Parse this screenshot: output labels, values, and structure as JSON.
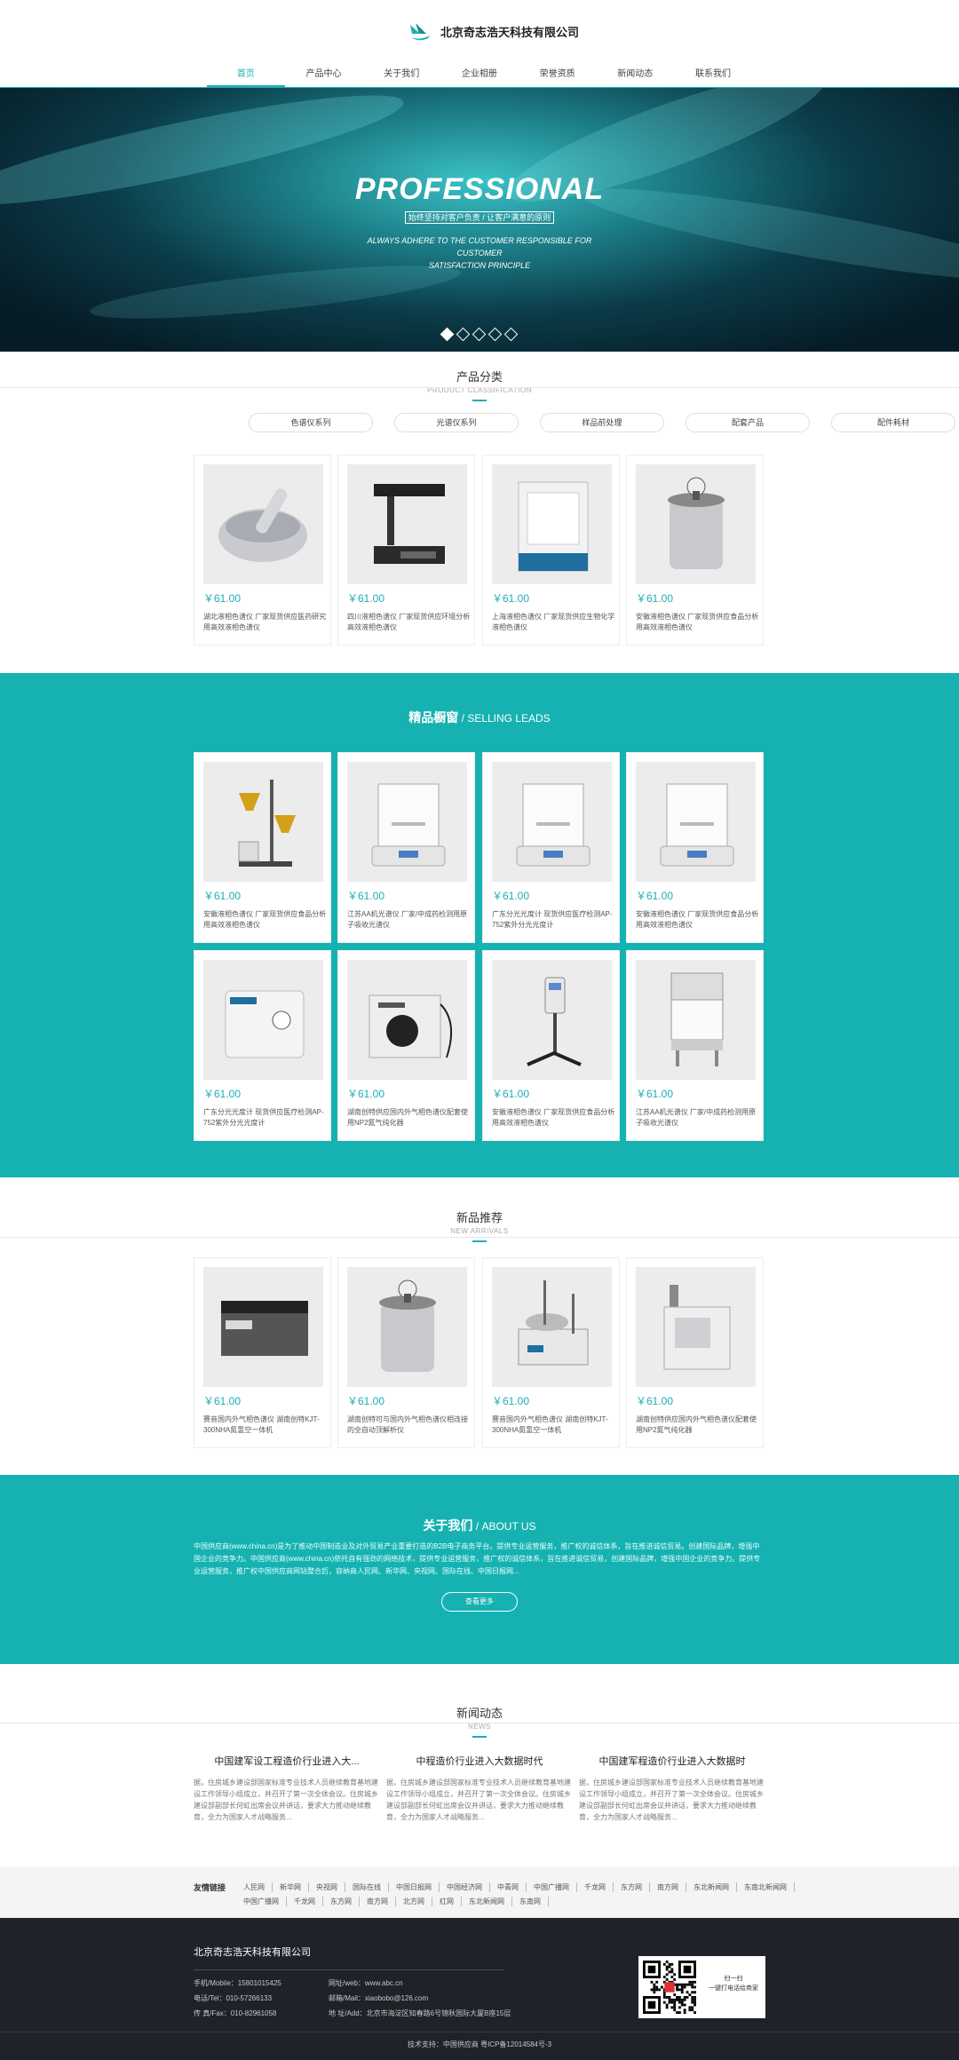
{
  "header": {
    "company": "北京奇志浩天科技有限公司",
    "nav": [
      "首页",
      "产品中心",
      "关于我们",
      "企业相册",
      "荣誉资质",
      "新闻动态",
      "联系我们"
    ],
    "active_index": 0
  },
  "banner": {
    "title": "PROFESSIONAL",
    "subtitle": "始终坚持对客户负责 / 让客户满意的原则",
    "en_line1": "ALWAYS ADHERE TO THE CUSTOMER RESPONSIBLE FOR CUSTOMER",
    "en_line2": "SATISFACTION PRINCIPLE",
    "dots": 5,
    "active_dot": 0
  },
  "classification": {
    "title": "产品分类",
    "subtitle": "PRODUCT CLASSIFICATION",
    "tabs": [
      "色谱仪系列",
      "光谱仪系列",
      "样品前处理",
      "配套产品",
      "配件耗材"
    ],
    "products": [
      {
        "price": "￥61.00",
        "desc": "湖北液相色谱仪 厂家现货供应医药研究用高效液相色谱仪",
        "icon": "mortar-icon"
      },
      {
        "price": "￥61.00",
        "desc": "四川液相色谱仪 厂家现货供应环境分析高效液相色谱仪",
        "icon": "uv-lamp-icon"
      },
      {
        "price": "￥61.00",
        "desc": "上海液相色谱仪 厂家现货供应生物化学液相色谱仪",
        "icon": "incubator-icon"
      },
      {
        "price": "￥61.00",
        "desc": "安徽液相色谱仪 厂家现货供应食品分析用高效液相色谱仪",
        "icon": "autoclave-icon"
      }
    ]
  },
  "selling": {
    "title_cn": "精品橱窗",
    "title_sep": " / ",
    "title_en": "SELLING LEADS",
    "products": [
      {
        "price": "￥61.00",
        "desc": "安徽液相色谱仪 厂家现货供应食品分析用高效液相色谱仪",
        "icon": "funnel-stand-icon"
      },
      {
        "price": "￥61.00",
        "desc": "江苏AA机光谱仪 厂家/中成药检测用原子吸收光谱仪",
        "icon": "balance-icon"
      },
      {
        "price": "￥61.00",
        "desc": "广东分光光度计 现货供应医疗检测AP-752紫外分光光度计",
        "icon": "balance-icon"
      },
      {
        "price": "￥61.00",
        "desc": "安徽液相色谱仪 厂家现货供应食品分析用高效液相色谱仪",
        "icon": "balance-icon"
      },
      {
        "price": "￥61.00",
        "desc": "广东分光光度计 现货供应医疗检测AP-752紫外分光光度计",
        "icon": "vacuum-pump-icon"
      },
      {
        "price": "￥61.00",
        "desc": "湖南创特供应国内外气相色谱仪配套使用NP2氮气纯化器",
        "icon": "purifier-icon"
      },
      {
        "price": "￥61.00",
        "desc": "安徽液相色谱仪 厂家现货供应食品分析用高效液相色谱仪",
        "icon": "viscometer-icon"
      },
      {
        "price": "￥61.00",
        "desc": "江苏AA机光谱仪 厂家/中成药检测用原子吸收光谱仪",
        "icon": "clean-bench-icon"
      }
    ]
  },
  "arrivals": {
    "title": "新品推荐",
    "subtitle": "NEW ARRIVALS",
    "products": [
      {
        "price": "￥61.00",
        "desc": "赛音国内外气相色谱仪 湖南创特KJT-300NHA氮氢空一体机",
        "icon": "hotplate-icon"
      },
      {
        "price": "￥61.00",
        "desc": "湖南创特可与国内外气相色谱仪相连接的全自动顶解析仪",
        "icon": "autoclave-icon"
      },
      {
        "price": "￥61.00",
        "desc": "赛音国内外气相色谱仪 湖南创特KJT-300NHA氮氢空一体机",
        "icon": "heating-bath-icon"
      },
      {
        "price": "￥61.00",
        "desc": "湖南创特供应国内外气相色谱仪配套使用NP2氮气纯化器",
        "icon": "furnace-icon"
      }
    ]
  },
  "about": {
    "title_cn": "关于我们",
    "title_sep": " / ",
    "title_en": "ABOUT US",
    "text": "中国供应商(www.china.cn)是为了推动中国制造业及对外贸易产业重要打造的B2B电子商务平台。提供专业运营服务，推广权的诚信体系，旨在推进诚信贸易。创建国际品牌，增强中国企业的竞争力。中国供应商(www.china.cn)依托自有强劲的网络技术，提供专业运营服务，推广权的诚信体系，旨在推进诚信贸易，创建国际品牌，增强中国企业的竞争力。提供专业运营服务，推广权中国供应商网站整合后，容纳商人民网、新华网、央视网、国际在线、中国日报网...",
    "button": "查看更多"
  },
  "news": {
    "title": "新闻动态",
    "subtitle": "NEWS",
    "items": [
      {
        "title": "中国建军设工程造价行业进入大...",
        "body": "据，住房城乡建设部国家标准专业技术人员继续教育基地建设工作领导小组成立，并召开了第一次全体会议。住房城乡建设部副部长何虹出席会议并讲话，要求大力推动继续教育，全力为国家人才战略服务..."
      },
      {
        "title": "中程造价行业进入大数据时代",
        "body": "据，住房城乡建设部国家标准专业技术人员继续教育基地建设工作领导小组成立，并召开了第一次全体会议。住房城乡建设部副部长何虹出席会议并讲话，要求大力推动继续教育，全力为国家人才战略服务..."
      },
      {
        "title": "中国建军程造价行业进入大数据时",
        "body": "据，住房城乡建设部国家标准专业技术人员继续教育基地建设工作领导小组成立，并召开了第一次全体会议。住房城乡建设部副部长何虹出席会议并讲话，要求大力推动继续教育，全力为国家人才战略服务..."
      }
    ]
  },
  "links": {
    "label": "友情链接",
    "row1": [
      "人民网",
      "新华网",
      "央视网",
      "国际在线",
      "中国日报网",
      "中国经济网",
      "中青网",
      "中国广播网",
      "千龙网",
      "东方网",
      "南方网",
      "东北新闻网",
      "东南北新闻网"
    ],
    "row2": [
      "中国广播网",
      "千龙网",
      "东方网",
      "南方网",
      "北方网",
      "红网",
      "东北新闻网",
      "东南网"
    ]
  },
  "footer": {
    "company": "北京奇志浩天科技有限公司",
    "mobile": "手机/Mobile：15801015425",
    "tel": "电话/Tel：010-57266133",
    "fax": "传 真/Fax：010-82961058",
    "web": "网址/web：www.abc.cn",
    "mail": "邮箱/Mail：xiaobobo@126.com",
    "address": "地 址/Add：北京市海淀区知春路6号锦秋国际大厦B座15层",
    "qr_text1": "扫一扫",
    "qr_text2": "一键打电话给商家",
    "bottom": "技术支持：中国供应商   粤ICP备12014584号-3"
  }
}
